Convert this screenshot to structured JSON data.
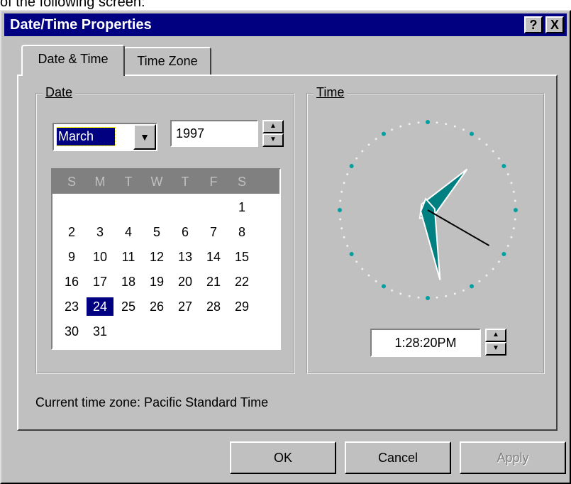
{
  "caption": "of the following screen:",
  "window": {
    "title": "Date/Time Properties",
    "help_label": "?",
    "close_label": "X"
  },
  "tabs": [
    {
      "label": "Date & Time",
      "active": true
    },
    {
      "label": "Time Zone",
      "active": false
    }
  ],
  "date_group": {
    "label": "Date",
    "month": "March",
    "year": "1997",
    "weekdays": [
      "S",
      "M",
      "T",
      "W",
      "T",
      "F",
      "S"
    ],
    "weeks": [
      [
        "",
        "",
        "",
        "",
        "",
        "",
        "1"
      ],
      [
        "2",
        "3",
        "4",
        "5",
        "6",
        "7",
        "8"
      ],
      [
        "9",
        "10",
        "11",
        "12",
        "13",
        "14",
        "15"
      ],
      [
        "16",
        "17",
        "18",
        "19",
        "20",
        "21",
        "22"
      ],
      [
        "23",
        "24",
        "25",
        "26",
        "27",
        "28",
        "29"
      ],
      [
        "30",
        "31",
        "",
        "",
        "",
        "",
        ""
      ]
    ],
    "selected_day": "24"
  },
  "time_group": {
    "label": "Time",
    "time": "1:28:20PM",
    "clock": {
      "hours": 1,
      "minutes": 28,
      "seconds": 20
    }
  },
  "current_timezone": "Current time zone:  Pacific Standard Time",
  "buttons": {
    "ok": "OK",
    "cancel": "Cancel",
    "apply": "Apply"
  },
  "colors": {
    "titlebar": "#000080",
    "face": "#c0c0c0",
    "clock_hand": "#008080",
    "selection": "#000080"
  }
}
